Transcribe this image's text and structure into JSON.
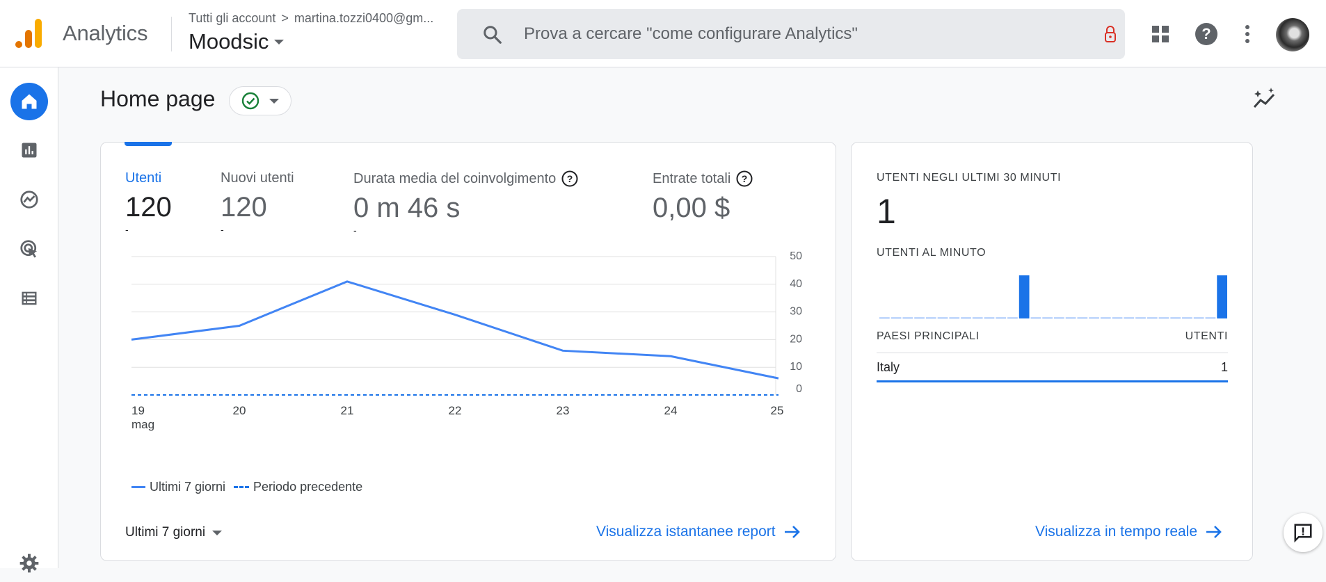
{
  "header": {
    "product_name": "Analytics",
    "breadcrumb_root": "Tutti gli account",
    "breadcrumb_sep": ">",
    "breadcrumb_account": "martina.tozzi0400@gm...",
    "property_name": "Moodsic",
    "search_placeholder": "Prova a cercare \"come configurare Analytics\"",
    "icons": [
      "apps-grid-icon",
      "help-icon",
      "more-vert-icon",
      "avatar"
    ]
  },
  "nav": {
    "items": [
      "home-icon",
      "reports-icon",
      "explore-icon",
      "advertising-icon",
      "configure-icon",
      "settings-icon"
    ],
    "active": "home"
  },
  "page": {
    "title": "Home page"
  },
  "metrics": [
    {
      "label": "Utenti",
      "value": "120",
      "dash": "-",
      "help": false,
      "active": true
    },
    {
      "label": "Nuovi utenti",
      "value": "120",
      "dash": "-",
      "help": false,
      "active": false
    },
    {
      "label": "Durata media del coinvolgimento",
      "value": "0 m 46 s",
      "dash": "-",
      "help": true,
      "active": false
    },
    {
      "label": "Entrate totali",
      "value": "0,00 $",
      "dash": "",
      "help": true,
      "active": false
    }
  ],
  "chart_data": {
    "type": "line",
    "categories": [
      "19",
      "20",
      "21",
      "22",
      "23",
      "24",
      "25"
    ],
    "x_sublabel": "mag",
    "series": [
      {
        "name": "Ultimi 7 giorni",
        "values": [
          20,
          25,
          41,
          29,
          16,
          14,
          6
        ],
        "style": "solid",
        "color": "#4285f4"
      },
      {
        "name": "Periodo precedente",
        "values": [
          0,
          0,
          0,
          0,
          0,
          0,
          0
        ],
        "style": "dashed",
        "color": "#1a73e8"
      }
    ],
    "y_ticks": [
      "50",
      "40",
      "30",
      "20",
      "10",
      "0"
    ],
    "ylim": [
      0,
      50
    ],
    "grid": true,
    "y_axis_side": "right",
    "legend_position": "bottom-left"
  },
  "main_card": {
    "range_label": "Ultimi 7 giorni",
    "link_label": "Visualizza istantanee report"
  },
  "realtime": {
    "title": "UTENTI NEGLI ULTIMI 30 MINUTI",
    "users_count": "1",
    "per_minute_label": "UTENTI AL MINUTO",
    "per_minute_values": [
      0,
      0,
      0,
      0,
      0,
      0,
      0,
      0,
      0,
      0,
      0,
      0,
      1,
      0,
      0,
      0,
      0,
      0,
      0,
      0,
      0,
      0,
      0,
      0,
      0,
      0,
      0,
      0,
      0,
      1
    ],
    "table_header_country": "PAESI PRINCIPALI",
    "table_header_users": "UTENTI",
    "rows": [
      {
        "country": "Italy",
        "users": "1"
      }
    ],
    "link_label": "Visualizza in tempo reale"
  },
  "colors": {
    "accent": "#1a73e8",
    "line": "#4285f4",
    "status_ok": "#188038",
    "lock": "#d93025"
  }
}
